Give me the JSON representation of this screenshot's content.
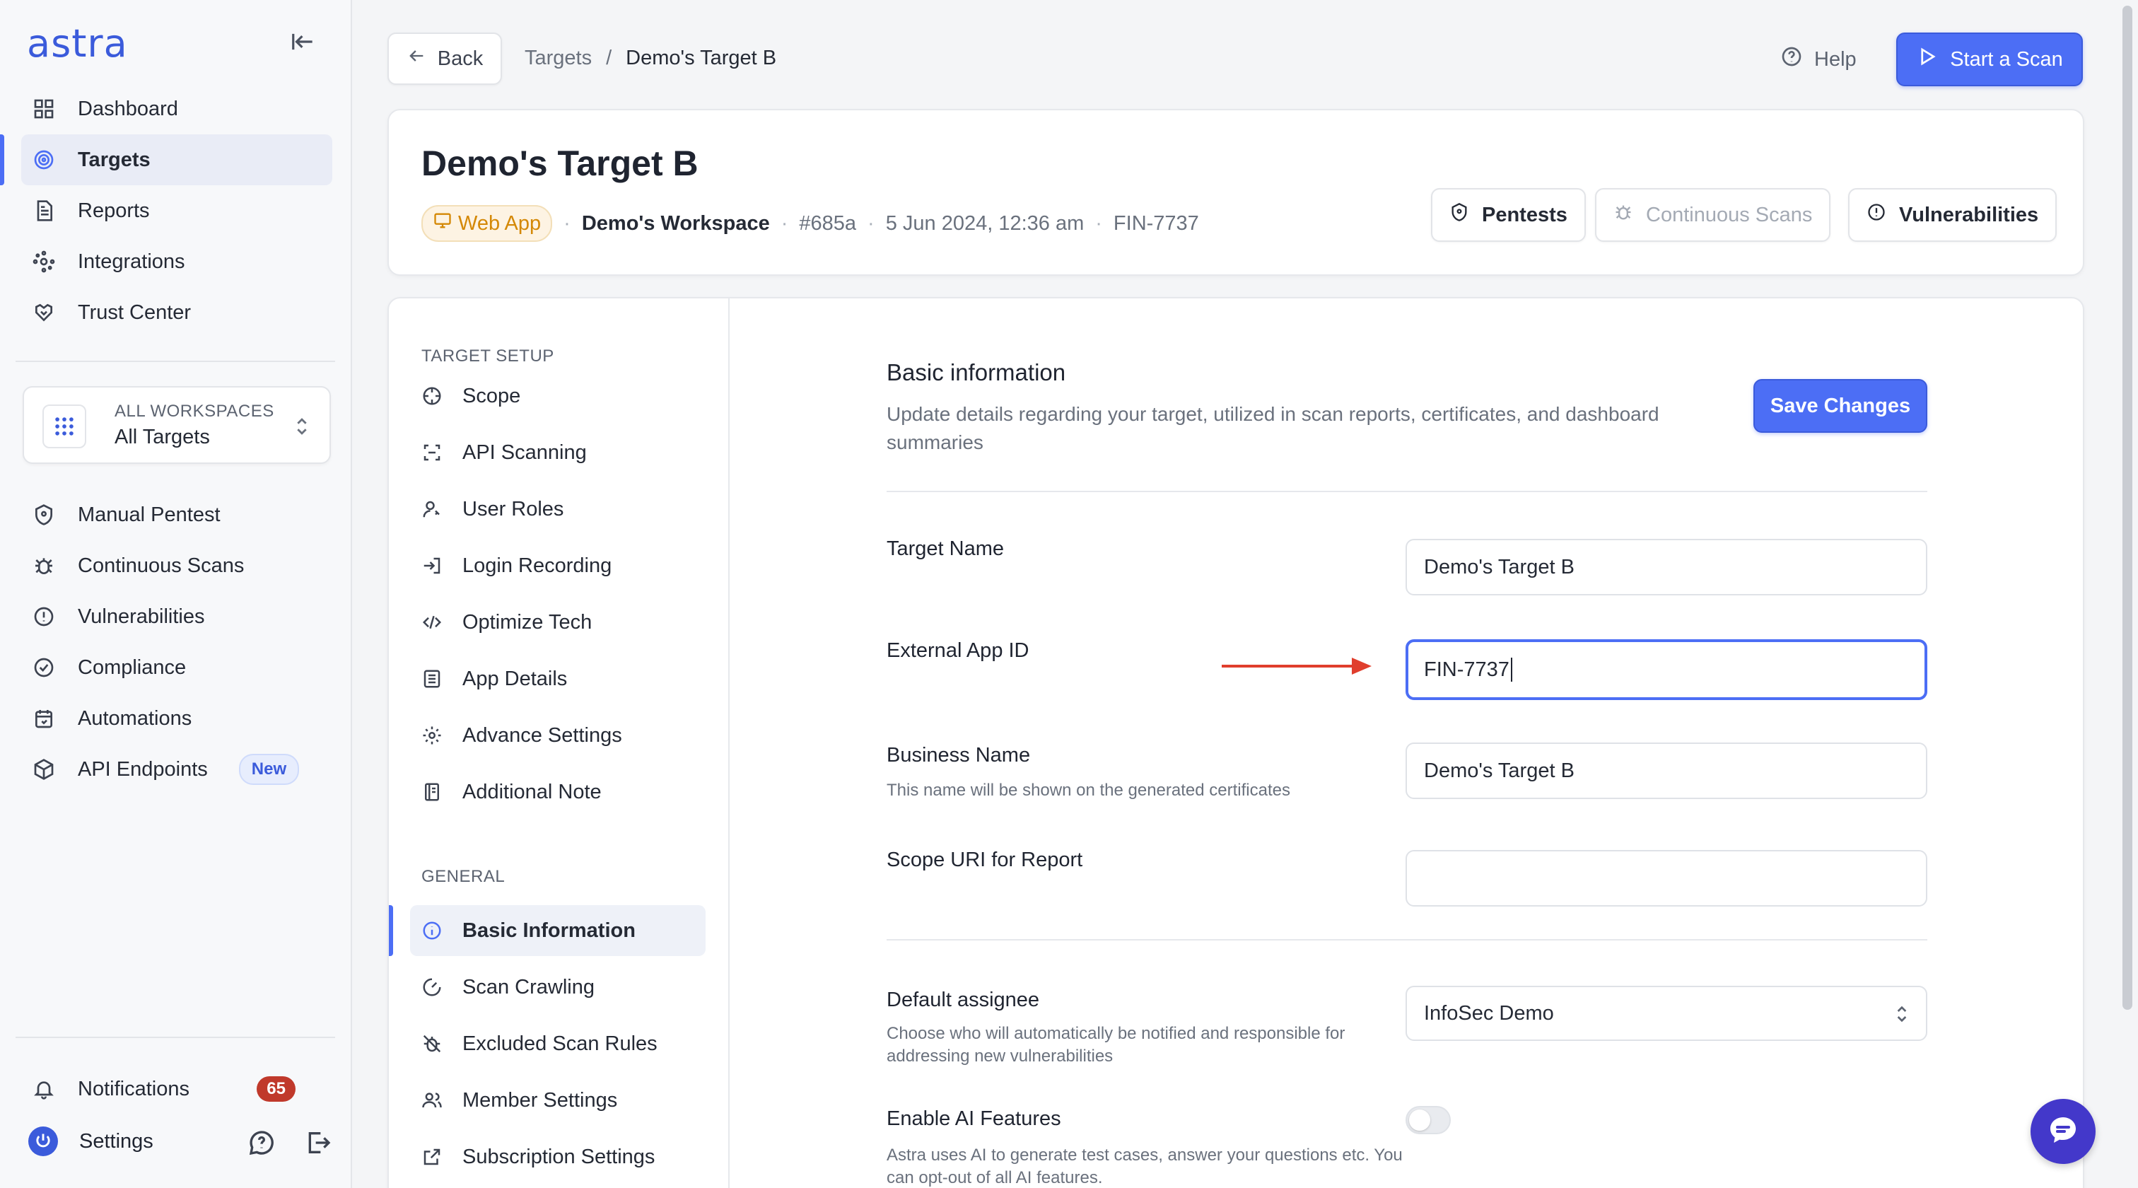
{
  "brand": {
    "logo": "astra",
    "accent": "#4c6ef5"
  },
  "sidebar": {
    "top_items": [
      {
        "label": "Dashboard",
        "icon": "grid-icon"
      },
      {
        "label": "Targets",
        "icon": "target-icon",
        "active": true
      },
      {
        "label": "Reports",
        "icon": "document-icon"
      },
      {
        "label": "Integrations",
        "icon": "integrations-icon"
      },
      {
        "label": "Trust Center",
        "icon": "handshake-icon"
      }
    ],
    "workspace": {
      "kicker": "ALL WORKSPACES",
      "title": "All Targets"
    },
    "mid_items": [
      {
        "label": "Manual Pentest",
        "icon": "shield-icon"
      },
      {
        "label": "Continuous Scans",
        "icon": "bug-icon"
      },
      {
        "label": "Vulnerabilities",
        "icon": "alert-circle-icon"
      },
      {
        "label": "Compliance",
        "icon": "check-circle-icon"
      },
      {
        "label": "Automations",
        "icon": "calendar-icon"
      },
      {
        "label": "API Endpoints",
        "icon": "cube-icon",
        "badge": "New"
      }
    ],
    "notifications": {
      "label": "Notifications",
      "count": "65"
    },
    "settings": {
      "label": "Settings"
    }
  },
  "topbar": {
    "back_label": "Back",
    "breadcrumb": [
      "Targets",
      "/",
      "Demo's Target B"
    ],
    "help_label": "Help",
    "start_scan_label": "Start a Scan"
  },
  "header": {
    "title": "Demo's Target B",
    "type_chip": "Web App",
    "workspace": "Demo's Workspace",
    "id": "#685a",
    "date": "5 Jun 2024, 12:36 am",
    "external_id": "FIN-7737",
    "buttons": {
      "pentests": "Pentests",
      "continuous": "Continuous Scans",
      "vulnerabilities": "Vulnerabilities"
    }
  },
  "subnav": {
    "setup_heading": "TARGET SETUP",
    "setup_items": [
      "Scope",
      "API Scanning",
      "User Roles",
      "Login Recording",
      "Optimize Tech",
      "App Details",
      "Advance Settings",
      "Additional Note"
    ],
    "general_heading": "GENERAL",
    "general_items": [
      "Basic Information",
      "Scan Crawling",
      "Excluded Scan Rules",
      "Member Settings",
      "Subscription Settings"
    ]
  },
  "form": {
    "title": "Basic information",
    "description": "Update details regarding your target, utilized in scan reports, certificates, and dashboard summaries",
    "save_label": "Save Changes",
    "target_name": {
      "label": "Target Name",
      "value": "Demo's Target B"
    },
    "external_id": {
      "label": "External App ID",
      "value": "FIN-7737"
    },
    "business_name": {
      "label": "Business Name",
      "help": "This name will be shown on the generated certificates",
      "value": "Demo's Target B"
    },
    "scope_uri": {
      "label": "Scope URI for Report",
      "value": ""
    },
    "assignee": {
      "label": "Default assignee",
      "help": "Choose who will automatically be notified and responsible for addressing new vulnerabilities",
      "value": "InfoSec Demo"
    },
    "ai": {
      "label": "Enable AI Features",
      "help": "Astra uses AI to generate test cases, answer your questions etc. You can opt-out of all AI features.",
      "enabled": false
    }
  },
  "colors": {
    "arrow": "#e03e2d",
    "notif_badge": "#c0392b",
    "chip_text": "#d48806"
  }
}
